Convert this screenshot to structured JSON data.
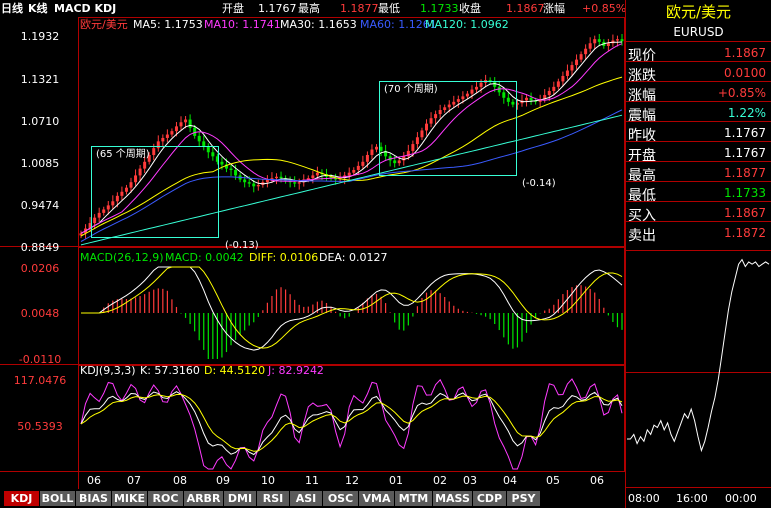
{
  "header": {
    "period_label": "日线",
    "chart_label": "K线",
    "indicators_label": "MACD KDJ",
    "fields": [
      {
        "label": "开盘",
        "value": "1.1767",
        "color": "#ffffff"
      },
      {
        "label": "最高",
        "value": "1.1877",
        "color": "#ff3b3b"
      },
      {
        "label": "最低",
        "value": "1.1733",
        "color": "#00e600"
      },
      {
        "label": "收盘",
        "value": "1.1867",
        "color": "#ff3b3b"
      },
      {
        "label": "涨幅",
        "value": "+0.85%",
        "color": "#ff3b3b"
      }
    ]
  },
  "price_panel": {
    "symbol_label": "欧元/美元",
    "ma_labels": [
      {
        "text": "MA5: 1.1753",
        "color": "#ffffff"
      },
      {
        "text": "MA10: 1.1741",
        "color": "#ff3bff"
      },
      {
        "text": "MA30: 1.1653",
        "color": "#ffffff"
      },
      {
        "text": "MA60: 1.1261",
        "color": "#3a5bff"
      },
      {
        "text": "MA120: 1.0962",
        "color": "#37ffd6"
      }
    ],
    "y_ticks": [
      "1.1932",
      "1.1321",
      "1.0710",
      "1.0085",
      "0.9474",
      "0.8849"
    ],
    "annotations": {
      "box1_label": "(65 个周期)",
      "box1_change": "(-0.13)",
      "box2_label": "(70 个周期)",
      "box2_change": "(-0.14)"
    },
    "close_series": [
      0.905,
      0.912,
      0.92,
      0.928,
      0.935,
      0.94,
      0.946,
      0.952,
      0.96,
      0.966,
      0.972,
      0.98,
      0.99,
      1.0,
      1.01,
      1.02,
      1.03,
      1.04,
      1.045,
      1.05,
      1.055,
      1.062,
      1.068,
      1.072,
      1.06,
      1.048,
      1.04,
      1.032,
      1.024,
      1.018,
      1.01,
      1.006,
      1.0,
      0.998,
      0.99,
      0.984,
      0.98,
      0.978,
      0.974,
      0.976,
      0.98,
      0.984,
      0.986,
      0.988,
      0.986,
      0.982,
      0.98,
      0.978,
      0.98,
      0.984,
      0.986,
      0.99,
      0.994,
      0.992,
      0.988,
      0.986,
      0.984,
      0.986,
      0.99,
      0.994,
      0.998,
      1.004,
      1.01,
      1.02,
      1.028,
      1.032,
      1.026,
      1.018,
      1.012,
      1.008,
      1.012,
      1.018,
      1.026,
      1.036,
      1.046,
      1.056,
      1.066,
      1.074,
      1.08,
      1.086,
      1.09,
      1.094,
      1.098,
      1.102,
      1.106,
      1.11,
      1.116,
      1.12,
      1.126,
      1.13,
      1.128,
      1.12,
      1.112,
      1.104,
      1.098,
      1.094,
      1.096,
      1.1,
      1.104,
      1.1,
      1.098,
      1.102,
      1.108,
      1.114,
      1.12,
      1.128,
      1.136,
      1.144,
      1.152,
      1.16,
      1.168,
      1.176,
      1.184,
      1.19,
      1.186,
      1.18,
      1.184,
      1.188,
      1.19,
      1.187
    ]
  },
  "macd_panel": {
    "title": "MACD(26,12,9)",
    "macd_label": "MACD: 0.0042",
    "diff_label": "DIFF: 0.0106",
    "dea_label": "DEA: 0.0127",
    "y_ticks": [
      "0.0206",
      "0.0048",
      "-0.0110"
    ]
  },
  "kdj_panel": {
    "title": "KDJ(9,3,3)",
    "k_label": "K: 57.3160",
    "d_label": "D: 44.5120",
    "j_label": "J: 82.9242",
    "y_ticks": [
      "117.0476",
      "50.5393"
    ]
  },
  "x_axis": {
    "labels": [
      "06",
      "07",
      "08",
      "09",
      "10",
      "11",
      "12",
      "01",
      "02",
      "03",
      "04",
      "05",
      "06"
    ]
  },
  "quote": {
    "name": "欧元/美元",
    "code": "EURUSD",
    "rows": [
      {
        "label": "现价",
        "value": "1.1867",
        "color": "#ff3b3b"
      },
      {
        "label": "涨跌",
        "value": "0.0100",
        "color": "#ff3b3b"
      },
      {
        "label": "涨幅",
        "value": "+0.85%",
        "color": "#ff3b3b"
      },
      {
        "label": "震幅",
        "value": "1.22%",
        "color": "#37ffd6"
      },
      {
        "label": "昨收",
        "value": "1.1767",
        "color": "#ffffff"
      },
      {
        "label": "开盘",
        "value": "1.1767",
        "color": "#ffffff"
      },
      {
        "label": "最高",
        "value": "1.1877",
        "color": "#ff3b3b"
      },
      {
        "label": "最低",
        "value": "1.1733",
        "color": "#00e600"
      },
      {
        "label": "买入",
        "value": "1.1867",
        "color": "#ff3b3b"
      },
      {
        "label": "卖出",
        "value": "1.1872",
        "color": "#ff3b3b"
      }
    ],
    "intraday_times": [
      "08:00",
      "16:00",
      "00:00"
    ],
    "intraday_series": [
      0.2,
      0.2,
      0.22,
      0.18,
      0.21,
      0.19,
      0.24,
      0.22,
      0.26,
      0.25,
      0.28,
      0.24,
      0.27,
      0.22,
      0.19,
      0.23,
      0.27,
      0.31,
      0.29,
      0.33,
      0.28,
      0.21,
      0.15,
      0.19,
      0.25,
      0.32,
      0.38,
      0.46,
      0.56,
      0.66,
      0.76,
      0.84,
      0.9,
      0.96,
      0.98,
      0.95,
      0.97,
      0.96,
      0.97,
      0.95,
      0.96,
      0.97,
      0.96
    ]
  },
  "tabs": [
    "KDJ",
    "BOLL",
    "BIAS",
    "MIKE",
    "ROC",
    "ARBR",
    "DMI",
    "RSI",
    "ASI",
    "OSC",
    "VMA",
    "MTM",
    "MASS",
    "CDP",
    "PSY"
  ],
  "active_tab": "KDJ",
  "colors": {
    "grid_red": "#b00000",
    "up": "#ff3b3b",
    "down": "#00e600",
    "yellow": "#ffff00",
    "magenta": "#ff3bff",
    "cyan": "#37ffd6",
    "blue": "#3a5bff"
  }
}
